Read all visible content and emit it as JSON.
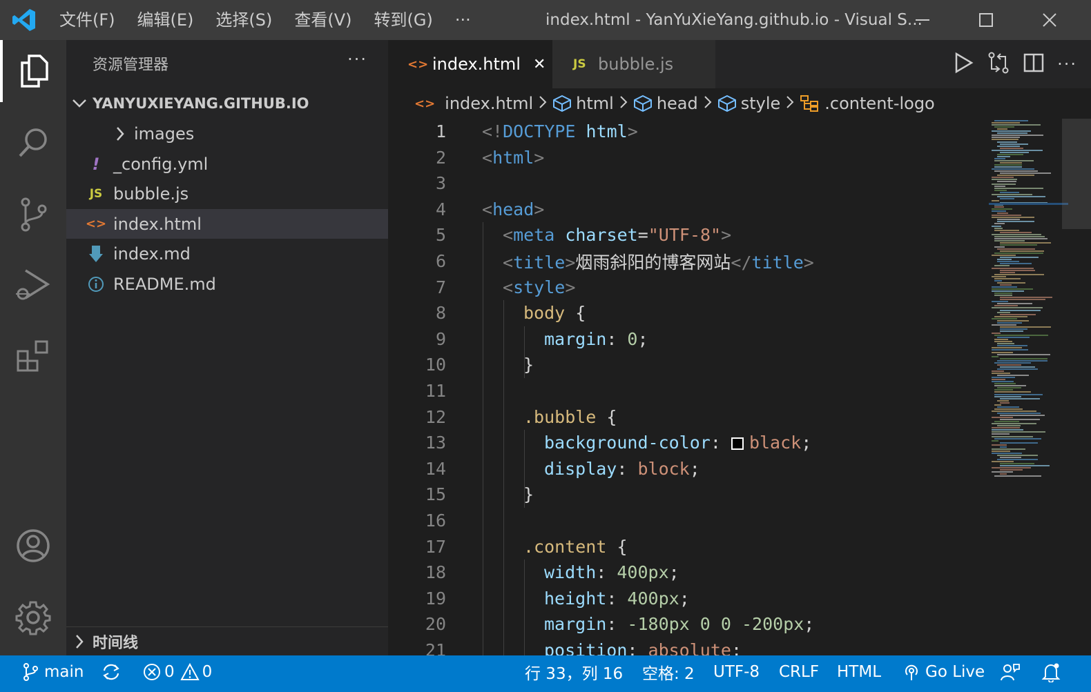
{
  "titlebar": {
    "menus": [
      "文件(F)",
      "编辑(E)",
      "选择(S)",
      "查看(V)",
      "转到(G)",
      "···"
    ],
    "window_title": "index.html - YanYuXieYang.github.io - Visual S..."
  },
  "activity_bar": {
    "items": [
      "explorer-icon",
      "search-icon",
      "source-control-icon",
      "run-debug-icon",
      "extensions-icon"
    ],
    "bottom": [
      "account-icon",
      "settings-gear-icon"
    ]
  },
  "sidebar": {
    "title": "资源管理器",
    "more": "···",
    "folder": "YANYUXIEYANG.GITHUB.IO",
    "tree": [
      {
        "name": "images",
        "type": "folder"
      },
      {
        "name": "_config.yml",
        "type": "yml",
        "icon_text": "!"
      },
      {
        "name": "bubble.js",
        "type": "js",
        "icon_text": "JS"
      },
      {
        "name": "index.html",
        "type": "html",
        "icon_text": "<>",
        "selected": true
      },
      {
        "name": "index.md",
        "type": "md"
      },
      {
        "name": "README.md",
        "type": "info"
      }
    ],
    "timeline": "时间线"
  },
  "editor": {
    "tabs": [
      {
        "label": "index.html",
        "icon_text": "<>",
        "active": true,
        "close": "✕"
      },
      {
        "label": "bubble.js",
        "icon_text": "JS",
        "active": false
      }
    ],
    "breadcrumb": [
      {
        "label": "index.html",
        "icon": "html-file-icon"
      },
      {
        "label": "html",
        "icon": "cube-icon"
      },
      {
        "label": "head",
        "icon": "cube-icon"
      },
      {
        "label": "style",
        "icon": "cube-icon"
      },
      {
        "label": ".content-logo",
        "icon": "css-selector-icon"
      }
    ],
    "current_line": 1,
    "lines": [
      {
        "n": "1",
        "indent": 0,
        "tokens": [
          [
            "c-punc",
            "<!"
          ],
          [
            "c-tag",
            "DOCTYPE "
          ],
          [
            "c-attr",
            "html"
          ],
          [
            "c-punc",
            ">"
          ]
        ]
      },
      {
        "n": "2",
        "indent": 0,
        "tokens": [
          [
            "c-punc",
            "<"
          ],
          [
            "c-tag",
            "html"
          ],
          [
            "c-punc",
            ">"
          ]
        ]
      },
      {
        "n": "3",
        "indent": 0,
        "tokens": []
      },
      {
        "n": "4",
        "indent": 0,
        "tokens": [
          [
            "c-punc",
            "<"
          ],
          [
            "c-tag",
            "head"
          ],
          [
            "c-punc",
            ">"
          ]
        ]
      },
      {
        "n": "5",
        "indent": 1,
        "tokens": [
          [
            "c-punc",
            "<"
          ],
          [
            "c-tag",
            "meta "
          ],
          [
            "c-attr",
            "charset"
          ],
          [
            "c-txt",
            "="
          ],
          [
            "c-str",
            "\"UTF-8\""
          ],
          [
            "c-punc",
            ">"
          ]
        ]
      },
      {
        "n": "6",
        "indent": 1,
        "tokens": [
          [
            "c-punc",
            "<"
          ],
          [
            "c-tag",
            "title"
          ],
          [
            "c-punc",
            ">"
          ],
          [
            "c-txt",
            "烟雨斜阳的博客网站"
          ],
          [
            "c-punc",
            "</"
          ],
          [
            "c-tag",
            "title"
          ],
          [
            "c-punc",
            ">"
          ]
        ]
      },
      {
        "n": "7",
        "indent": 1,
        "tokens": [
          [
            "c-punc",
            "<"
          ],
          [
            "c-tag",
            "style"
          ],
          [
            "c-punc",
            ">"
          ]
        ]
      },
      {
        "n": "8",
        "indent": 2,
        "tokens": [
          [
            "c-sel",
            "body "
          ],
          [
            "c-txt",
            "{"
          ]
        ]
      },
      {
        "n": "9",
        "indent": 3,
        "tokens": [
          [
            "c-prop",
            "margin"
          ],
          [
            "c-txt",
            ": "
          ],
          [
            "c-num",
            "0"
          ],
          [
            "c-txt",
            ";"
          ]
        ]
      },
      {
        "n": "10",
        "indent": 2,
        "tokens": [
          [
            "c-txt",
            "}"
          ]
        ]
      },
      {
        "n": "11",
        "indent": 2,
        "tokens": []
      },
      {
        "n": "12",
        "indent": 2,
        "tokens": [
          [
            "c-sel",
            ".bubble "
          ],
          [
            "c-txt",
            "{"
          ]
        ]
      },
      {
        "n": "13",
        "indent": 3,
        "tokens": [
          [
            "c-prop",
            "background-color"
          ],
          [
            "c-txt",
            ": "
          ],
          [
            "swatch",
            ""
          ],
          [
            "c-str",
            "black"
          ],
          [
            "c-txt",
            ";"
          ]
        ]
      },
      {
        "n": "14",
        "indent": 3,
        "tokens": [
          [
            "c-prop",
            "display"
          ],
          [
            "c-txt",
            ": "
          ],
          [
            "c-str",
            "block"
          ],
          [
            "c-txt",
            ";"
          ]
        ]
      },
      {
        "n": "15",
        "indent": 2,
        "tokens": [
          [
            "c-txt",
            "}"
          ]
        ]
      },
      {
        "n": "16",
        "indent": 2,
        "tokens": []
      },
      {
        "n": "17",
        "indent": 2,
        "tokens": [
          [
            "c-sel",
            ".content "
          ],
          [
            "c-txt",
            "{"
          ]
        ]
      },
      {
        "n": "18",
        "indent": 3,
        "tokens": [
          [
            "c-prop",
            "width"
          ],
          [
            "c-txt",
            ": "
          ],
          [
            "c-num",
            "400px"
          ],
          [
            "c-txt",
            ";"
          ]
        ]
      },
      {
        "n": "19",
        "indent": 3,
        "tokens": [
          [
            "c-prop",
            "height"
          ],
          [
            "c-txt",
            ": "
          ],
          [
            "c-num",
            "400px"
          ],
          [
            "c-txt",
            ";"
          ]
        ]
      },
      {
        "n": "20",
        "indent": 3,
        "tokens": [
          [
            "c-prop",
            "margin"
          ],
          [
            "c-txt",
            ": "
          ],
          [
            "c-num",
            "-180px 0 0 -200px"
          ],
          [
            "c-txt",
            ";"
          ]
        ]
      },
      {
        "n": "21",
        "indent": 3,
        "tokens": [
          [
            "c-prop",
            "position"
          ],
          [
            "c-txt",
            ": "
          ],
          [
            "c-str",
            "absolute"
          ],
          [
            "c-txt",
            ";"
          ]
        ]
      }
    ]
  },
  "statusbar": {
    "branch": "main",
    "errors": "0",
    "warnings": "0",
    "position": "行 33，列 16",
    "spaces": "空格: 2",
    "encoding": "UTF-8",
    "eol": "CRLF",
    "language": "HTML",
    "go_live": "Go Live"
  },
  "colors": {
    "statusbar": "#007acc",
    "titlebar": "#3c3c3c",
    "activitybar": "#333333",
    "sidebar": "#252526",
    "editor": "#1e1e1e",
    "accent_logo": "#23a9f2"
  }
}
